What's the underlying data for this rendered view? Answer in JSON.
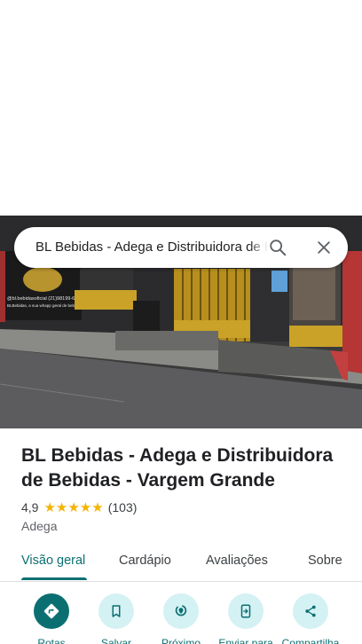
{
  "search": {
    "query": "BL Bebidas - Adega e Distribuidora de Bebidas - Vargem Grande",
    "search_icon": "search-icon",
    "close_icon": "close-icon"
  },
  "photo": {
    "sign_line_1": "@bl.bebidasoficial (21)98199-6541",
    "sign_line_2": "BLBebidas, a sua whapp geral de bebidas"
  },
  "place": {
    "title": "BL Bebidas - Adega e Distribuidora de Bebidas - Vargem Grande",
    "rating": "4,9",
    "stars": "★★★★★",
    "review_count": "(103)",
    "category": "Adega"
  },
  "tabs": [
    {
      "label": "Visão geral",
      "active": true
    },
    {
      "label": "Cardápio",
      "active": false
    },
    {
      "label": "Avaliações",
      "active": false
    },
    {
      "label": "Sobre",
      "active": false
    }
  ],
  "actions": [
    {
      "label": "Rotas",
      "icon": "directions-icon"
    },
    {
      "label": "Salvar",
      "icon": "bookmark-icon"
    },
    {
      "label": "Próximo",
      "icon": "nearby-icon"
    },
    {
      "label": "Enviar para",
      "icon": "send-to-phone-icon"
    },
    {
      "label": "Compartilha",
      "icon": "share-icon"
    }
  ],
  "colors": {
    "accent": "#0b6f72",
    "accent_light": "#d4f1f3",
    "star": "#f5b400"
  }
}
